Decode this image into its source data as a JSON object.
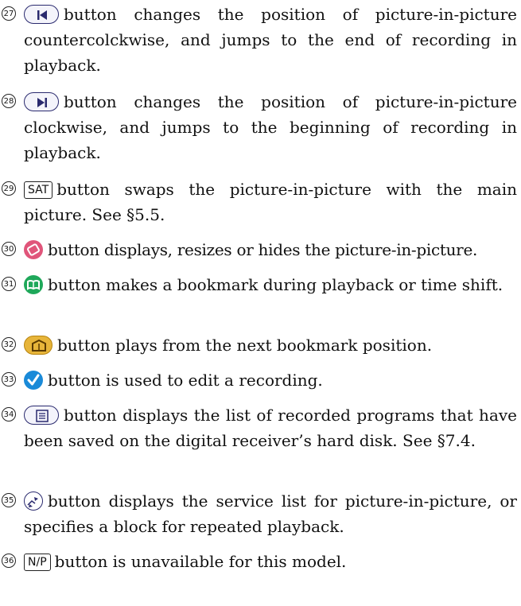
{
  "items": [
    {
      "num": "27",
      "text_a": "button changes the position of picture-in-picture countercolckwise, and jumps to the end of recording in playback."
    },
    {
      "num": "28",
      "text_a": "button changes the position of picture-in-picture clockwise, and jumps to the beginning of recording in playback."
    },
    {
      "num": "29",
      "key_label": "SAT",
      "text_a": "button swaps the picture-in-picture with the main picture. See §5.5."
    },
    {
      "num": "30",
      "text_a": "button displays, resizes or hides the picture-in-picture."
    },
    {
      "num": "31",
      "text_a": "button makes a bookmark during playback or time shift."
    },
    {
      "num": "32",
      "text_a": "button plays from the next bookmark position."
    },
    {
      "num": "33",
      "text_a": "button is used to edit a recording."
    },
    {
      "num": "34",
      "text_a": "button displays the list of recorded programs that have been saved on the digital receiver’s hard disk. See §7.4."
    },
    {
      "num": "35",
      "text_a": "button displays the service list for picture-in-picture, or specifies a block for repeated playback."
    },
    {
      "num": "36",
      "key_label": "N/P",
      "text_a": "button is unavailable for this model."
    }
  ],
  "icons": {
    "item27": "skip-back-icon",
    "item28": "skip-forward-icon",
    "item30": "pip-icon",
    "item31": "bookmark-icon",
    "item32": "next-bookmark-icon",
    "item33": "edit-check-icon",
    "item34": "list-icon",
    "item35": "service-list-icon"
  },
  "colors": {
    "pip": "#e0557a",
    "bookmark": "#1fa85a",
    "next_bookmark": "#e7b53a",
    "edit": "#1a8ad8"
  }
}
